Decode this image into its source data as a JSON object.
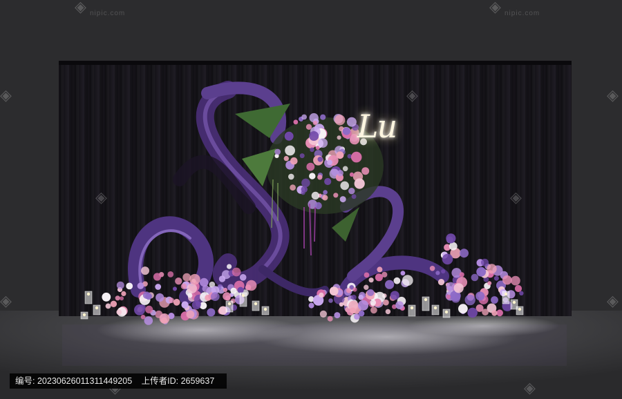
{
  "scene": {
    "neon_sign_text": "Lu",
    "caption": {
      "id_label": "编号:",
      "id_value": "20230626011311449205",
      "uploader_label": "上传者ID:",
      "uploader_value": "2659637"
    },
    "watermark_site": "nipic.com",
    "colors": {
      "backdrop": "#141217",
      "curtain": "#1c1a20",
      "floor": "#3a3a3d",
      "ribbon": "#5b3f8e",
      "accent_pink": "#e98fb6",
      "accent_lilac": "#b58de0"
    }
  }
}
